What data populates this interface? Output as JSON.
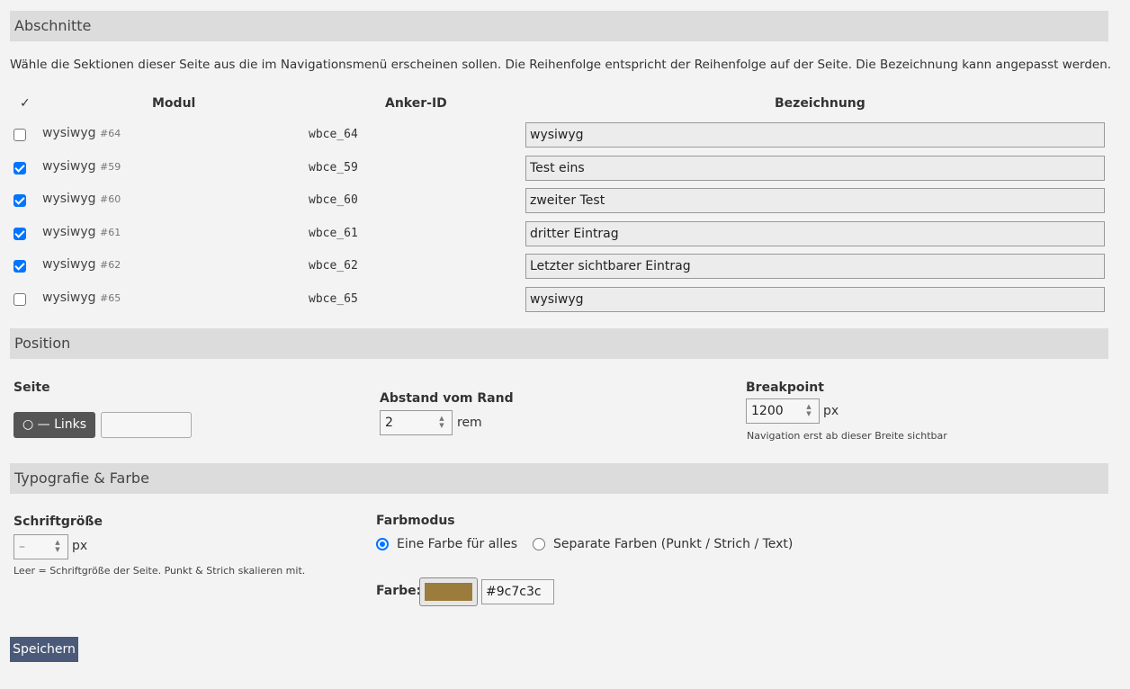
{
  "sections_panel": {
    "title": "Abschnitte",
    "description": "Wähle die Sektionen dieser Seite aus die im Navigationsmenü erscheinen sollen. Die Reihenfolge entspricht der Reihenfolge auf der Seite. Die Bezeichnung kann angepasst werden.",
    "columns": {
      "check": "✓",
      "module": "Modul",
      "anchor": "Anker-ID",
      "label": "Bezeichnung"
    },
    "rows": [
      {
        "checked": false,
        "module": "wysiwyg",
        "id": "#64",
        "anchor": "wbce_64",
        "label": "wysiwyg"
      },
      {
        "checked": true,
        "module": "wysiwyg",
        "id": "#59",
        "anchor": "wbce_59",
        "label": "Test eins"
      },
      {
        "checked": true,
        "module": "wysiwyg",
        "id": "#60",
        "anchor": "wbce_60",
        "label": "zweiter Test"
      },
      {
        "checked": true,
        "module": "wysiwyg",
        "id": "#61",
        "anchor": "wbce_61",
        "label": "dritter Eintrag"
      },
      {
        "checked": true,
        "module": "wysiwyg",
        "id": "#62",
        "anchor": "wbce_62",
        "label": "Letzter sichtbarer Eintrag"
      },
      {
        "checked": false,
        "module": "wysiwyg",
        "id": "#65",
        "anchor": "wbce_65",
        "label": "wysiwyg"
      }
    ]
  },
  "position_panel": {
    "title": "Position",
    "side": {
      "label": "Seite",
      "left_button": "○ — Links"
    },
    "margin": {
      "label": "Abstand vom Rand",
      "value": "2",
      "unit": "rem"
    },
    "breakpoint": {
      "label": "Breakpoint",
      "value": "1200",
      "unit": "px",
      "hint": "Navigation erst ab dieser Breite sichtbar"
    }
  },
  "typography_panel": {
    "title": "Typografie & Farbe",
    "font_size": {
      "label": "Schriftgröße",
      "value": "–",
      "unit": "px",
      "hint": "Leer = Schriftgröße der Seite. Punkt & Strich skalieren mit."
    },
    "color_mode": {
      "label": "Farbmodus",
      "options": [
        {
          "label": "Eine Farbe für alles",
          "selected": true
        },
        {
          "label": "Separate Farben (Punkt / Strich / Text)",
          "selected": false
        }
      ]
    },
    "color": {
      "label": "Farbe:",
      "value": "#9c7c3c"
    }
  },
  "save_button": "Speichern"
}
